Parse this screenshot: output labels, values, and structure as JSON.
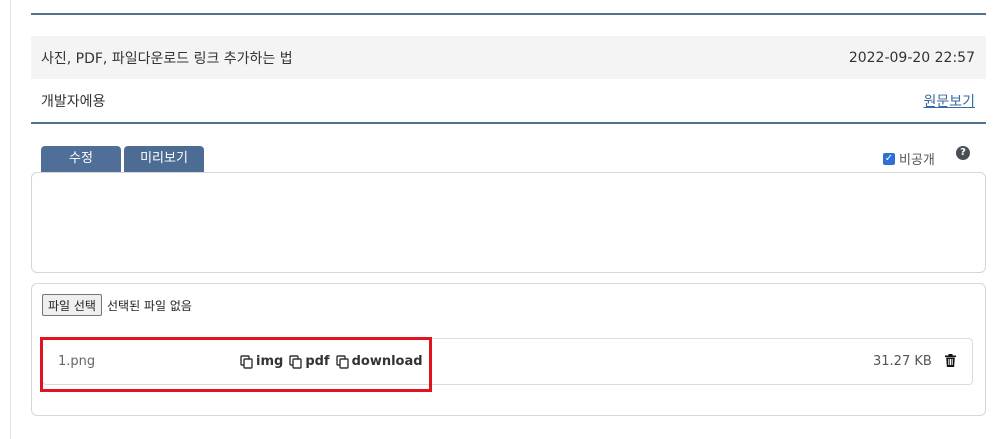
{
  "post": {
    "title": "사진, PDF, 파일다운로드 링크 추가하는 법",
    "date": "2022-09-20 22:57",
    "category": "개발자에용",
    "view_original": "원문보기"
  },
  "editor": {
    "tabs": [
      {
        "label": "수정"
      },
      {
        "label": "미리보기"
      }
    ],
    "private_label": "비공개",
    "private_checked": true
  },
  "upload": {
    "choose_label": "파일 선택",
    "no_file_label": "선택된 파일 없음",
    "files": [
      {
        "name": "1.png",
        "links": [
          "img",
          "pdf",
          "download"
        ],
        "size": "31.27 KB"
      }
    ]
  },
  "colors": {
    "accent": "#4f6f98",
    "rule": "#52708f",
    "highlight": "#e0141c",
    "link": "#3a6aa0"
  },
  "icons": [
    "copy-icon",
    "trash-icon",
    "question-icon",
    "checkbox-checked-icon"
  ]
}
